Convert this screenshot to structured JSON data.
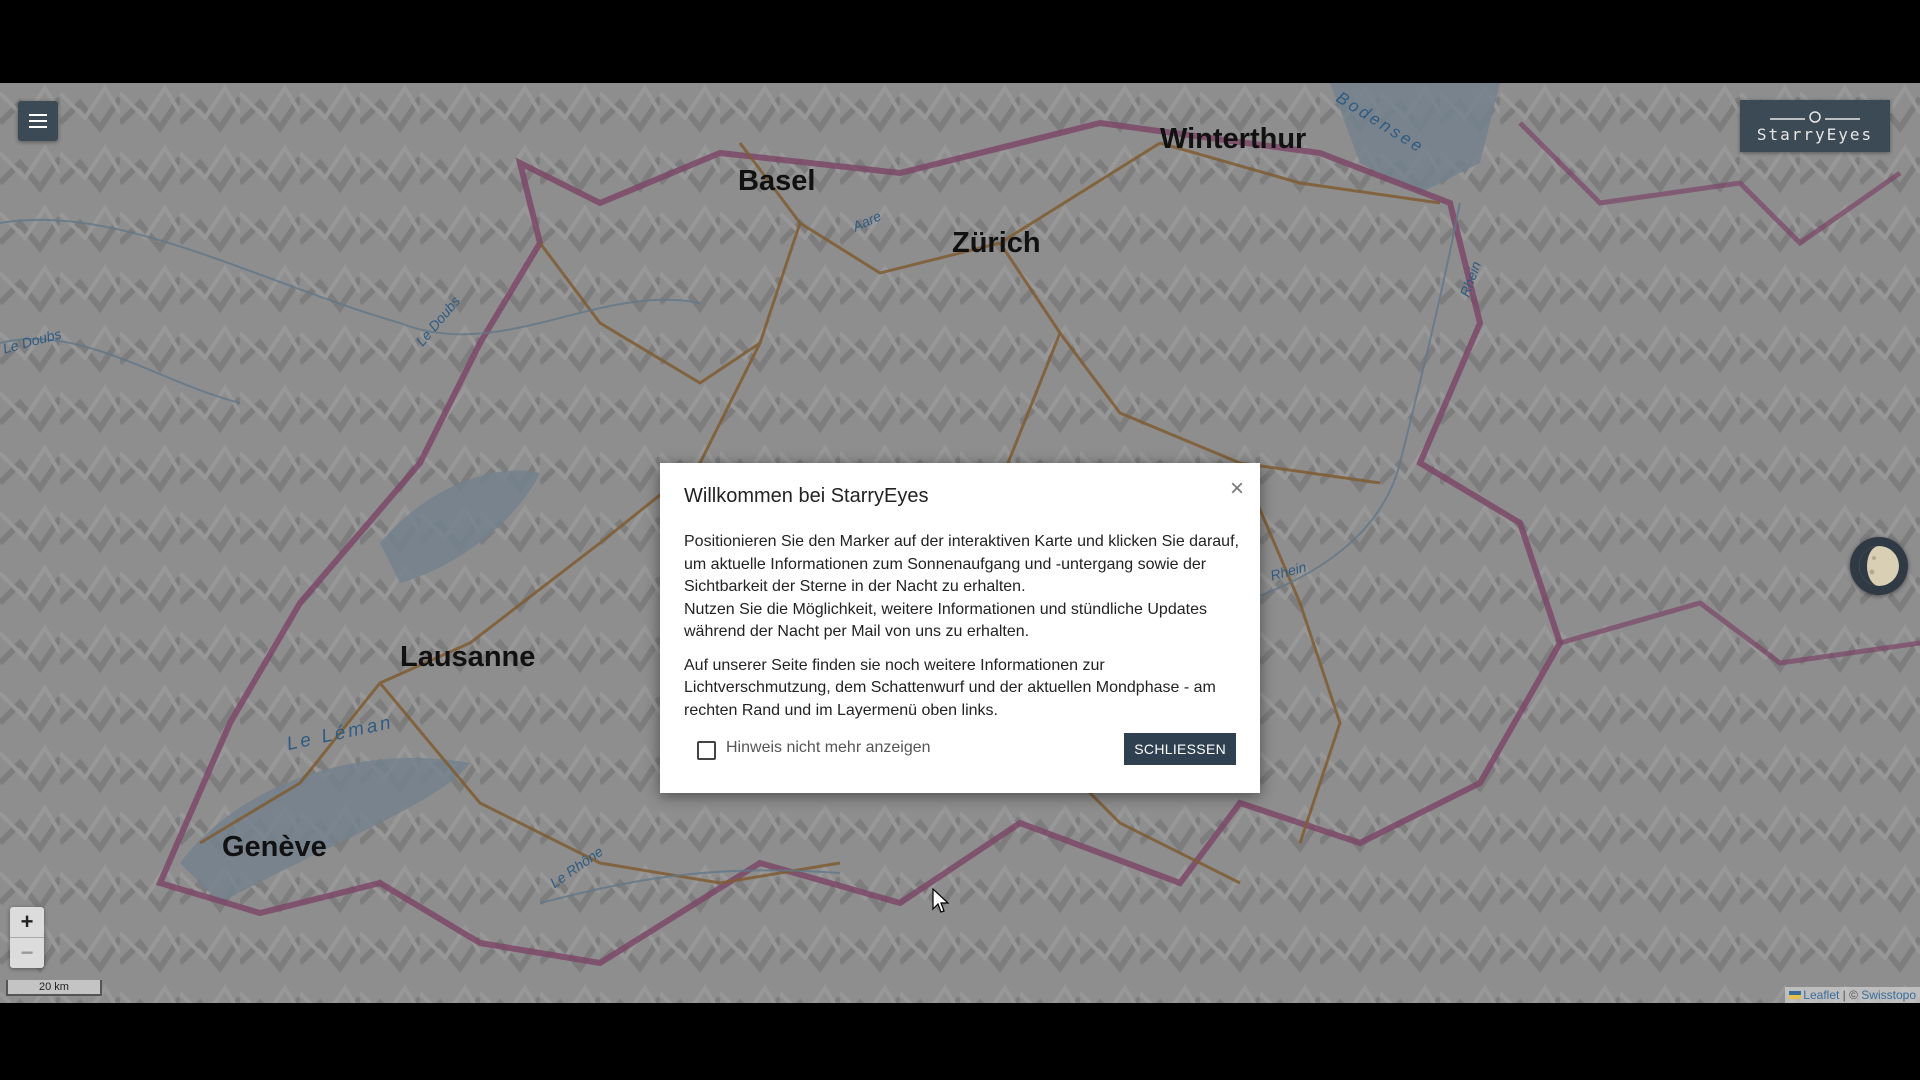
{
  "app": {
    "logo_text": "StarryEyes"
  },
  "map": {
    "cities": [
      {
        "name": "Basel"
      },
      {
        "name": "Winterthur"
      },
      {
        "name": "Zürich"
      },
      {
        "name": "Lausanne"
      },
      {
        "name": "Genève"
      }
    ],
    "water_labels": [
      "Bodensee",
      "Aare",
      "Le Doubs",
      "Le Doubs",
      "Rhein",
      "Rhein",
      "Le Léman",
      "Le Rhône"
    ],
    "scale_label": "20 km",
    "attribution": {
      "leaflet": "Leaflet",
      "separator": " | © ",
      "provider": "Swisstopo"
    },
    "zoom_in": "+",
    "zoom_out": "−"
  },
  "icons": {
    "menu": "hamburger-icon",
    "moon": "moon-phase-icon",
    "close": "close-icon",
    "cursor": "mouse-cursor-icon"
  },
  "modal": {
    "title": "Willkommen bei StarryEyes",
    "close_symbol": "×",
    "paragraph1_line1": "Positionieren Sie den Marker auf der interaktiven Karte und klicken Sie darauf, um aktuelle Informationen zum Sonnenaufgang und -untergang sowie der Sichtbarkeit der Sterne in der Nacht zu erhalten.",
    "paragraph1_line2": "Nutzen Sie die Möglichkeit, weitere Informationen und stündliche Updates während der Nacht per Mail von uns zu erhalten.",
    "paragraph2": "Auf unserer Seite finden sie noch weitere Informationen zur Lichtverschmutzung, dem Schattenwurf und der aktuellen Mondphase - am rechten Rand und im Layermenü oben links.",
    "checkbox_label": "Hinweis nicht mehr anzeigen",
    "checkbox_checked": false,
    "close_button": "SCHLIESSEN"
  }
}
